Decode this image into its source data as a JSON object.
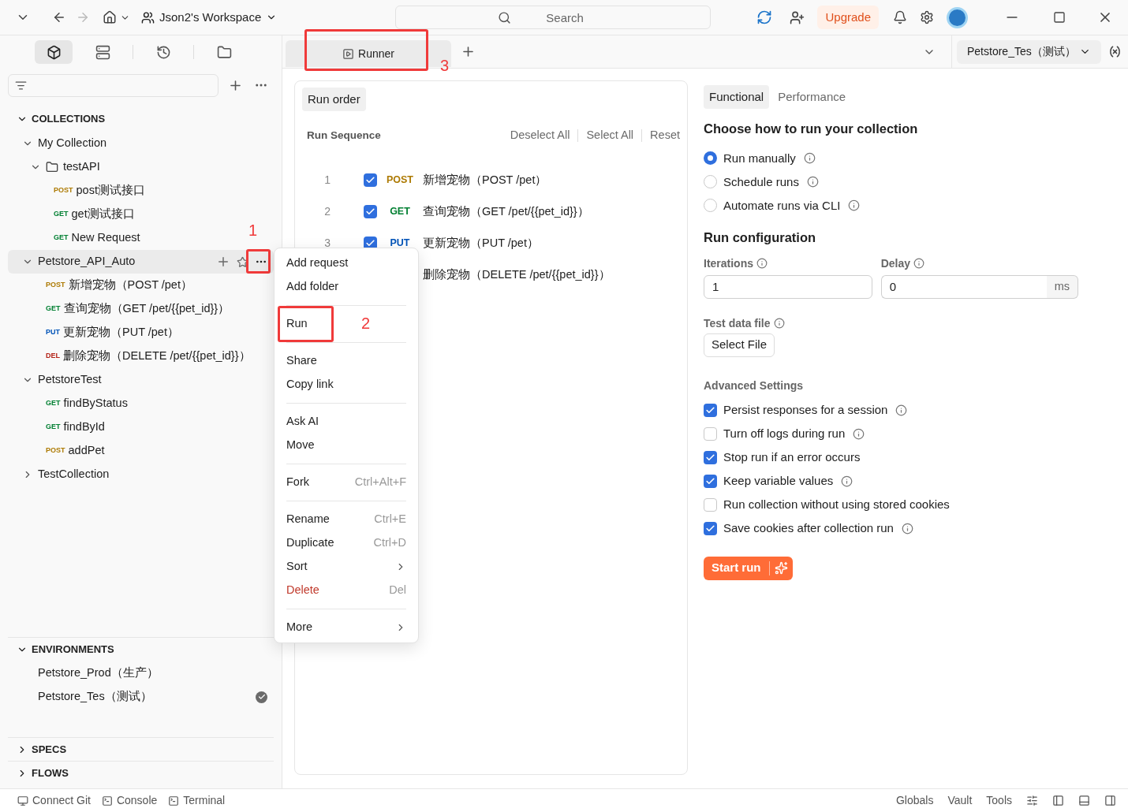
{
  "titlebar": {
    "workspace": "Json2's Workspace",
    "search": {
      "placeholder": "Search"
    },
    "upgrade": "Upgrade",
    "forward_disabled": true
  },
  "sidebar": {
    "views": [
      {
        "kind": "collections",
        "selected": true
      },
      {
        "kind": "environments",
        "selected": false
      },
      {
        "kind": "history",
        "selected": false
      },
      {
        "kind": "files",
        "selected": false
      }
    ],
    "collections": {
      "title": "COLLECTIONS",
      "expanded": true,
      "items": [
        {
          "kind": "collection",
          "name": "My Collection",
          "expanded": true,
          "selected": false,
          "children": [
            {
              "kind": "folder",
              "name": "testAPI",
              "expanded": true,
              "selected": false,
              "children": [
                {
                  "kind": "request",
                  "method": "POST",
                  "name": "post测试接口",
                  "selected": false
                },
                {
                  "kind": "request",
                  "method": "GET",
                  "name": "get测试接口",
                  "selected": false
                },
                {
                  "kind": "request",
                  "method": "GET",
                  "name": "New Request",
                  "selected": false
                }
              ]
            }
          ]
        },
        {
          "kind": "collection",
          "name": "Petstore_API_Auto",
          "expanded": true,
          "selected": true,
          "annotation": "1",
          "children": [
            {
              "kind": "request",
              "method": "POST",
              "name": "新增宠物（POST /pet）",
              "selected": false
            },
            {
              "kind": "request",
              "method": "GET",
              "name": "查询宠物（GET /pet/{{pet_id}}）",
              "selected": false
            },
            {
              "kind": "request",
              "method": "PUT",
              "name": "更新宠物（PUT /pet）",
              "selected": false
            },
            {
              "kind": "request",
              "method": "DEL",
              "name": "删除宠物（DELETE /pet/{{pet_id}}）",
              "selected": false
            }
          ]
        },
        {
          "kind": "collection",
          "name": "PetstoreTest",
          "expanded": true,
          "selected": false,
          "children": [
            {
              "kind": "request",
              "method": "GET",
              "name": "findByStatus",
              "selected": false
            },
            {
              "kind": "request",
              "method": "GET",
              "name": "findById",
              "selected": false
            },
            {
              "kind": "request",
              "method": "POST",
              "name": "addPet",
              "selected": false
            }
          ]
        },
        {
          "kind": "collection",
          "name": "TestCollection",
          "expanded": false,
          "selected": false
        }
      ]
    },
    "environments": {
      "title": "ENVIRONMENTS",
      "expanded": true,
      "items": [
        {
          "name": "Petstore_Prod（生产）",
          "active": false
        },
        {
          "name": "Petstore_Tes（测试）",
          "active": true
        }
      ]
    },
    "sections": [
      {
        "title": "SPECS",
        "expanded": false
      },
      {
        "title": "FLOWS",
        "expanded": false
      }
    ]
  },
  "tabs": [
    {
      "label": "Runner",
      "selected": true,
      "annotation": "3"
    }
  ],
  "environment_selector": "Petstore_Tes（测试）",
  "run_order": {
    "tab": "Run order",
    "title": "Run Sequence",
    "actions": [
      "Deselect All",
      "Select All",
      "Reset"
    ],
    "rows": [
      {
        "number": "1",
        "checked": true,
        "method": "POST",
        "name": "新增宠物（POST /pet）"
      },
      {
        "number": "2",
        "checked": true,
        "method": "GET",
        "name": "查询宠物（GET /pet/{{pet_id}}）"
      },
      {
        "number": "3",
        "checked": true,
        "method": "PUT",
        "name": "更新宠物（PUT /pet）"
      },
      {
        "name": "删除宠物（DELETE /pet/{{pet_id}}）"
      }
    ]
  },
  "context_menu": [
    [
      {
        "label": "Add request"
      },
      {
        "label": "Add folder"
      }
    ],
    [
      {
        "label": "Run",
        "annotation": "2"
      }
    ],
    [
      {
        "label": "Share"
      },
      {
        "label": "Copy link"
      }
    ],
    [
      {
        "label": "Ask AI"
      },
      {
        "label": "Move"
      }
    ],
    [
      {
        "label": "Fork",
        "shortcut": "Ctrl+Alt+F"
      }
    ],
    [
      {
        "label": "Rename",
        "shortcut": "Ctrl+E"
      },
      {
        "label": "Duplicate",
        "shortcut": "Ctrl+D"
      },
      {
        "label": "Sort",
        "submenu": true
      },
      {
        "label": "Delete",
        "shortcut": "Del",
        "danger": true
      }
    ],
    [
      {
        "label": "More",
        "submenu": true
      }
    ]
  ],
  "settings": {
    "tabs": [
      {
        "label": "Functional",
        "selected": true
      },
      {
        "label": "Performance",
        "selected": false
      }
    ],
    "heading": "Choose how to run your collection",
    "run_modes": [
      {
        "label": "Run manually",
        "selected": true
      },
      {
        "label": "Schedule runs",
        "selected": false
      },
      {
        "label": "Automate runs via CLI",
        "selected": false
      }
    ],
    "config_heading": "Run configuration",
    "iterations": {
      "label": "Iterations",
      "value": "1"
    },
    "delay": {
      "label": "Delay",
      "value": "0",
      "unit": "ms"
    },
    "test_data": {
      "label": "Test data file",
      "button": "Select File"
    },
    "advanced_heading": "Advanced Settings",
    "options": [
      {
        "label": "Persist responses for a session",
        "checked": true,
        "info": true
      },
      {
        "label": "Turn off logs during run",
        "checked": false,
        "info": true
      },
      {
        "label": "Stop run if an error occurs",
        "checked": true,
        "info": false
      },
      {
        "label": "Keep variable values",
        "checked": true,
        "info": true
      },
      {
        "label": "Run collection without using stored cookies",
        "checked": false,
        "info": false
      },
      {
        "label": "Save cookies after collection run",
        "checked": true,
        "info": true
      }
    ],
    "start": "Start run"
  },
  "status_bar": {
    "left": [
      {
        "kind": "git",
        "label": "Connect Git"
      },
      {
        "kind": "console",
        "label": "Console"
      },
      {
        "kind": "terminal",
        "label": "Terminal"
      }
    ],
    "right": [
      "Globals",
      "Vault",
      "Tools"
    ]
  }
}
